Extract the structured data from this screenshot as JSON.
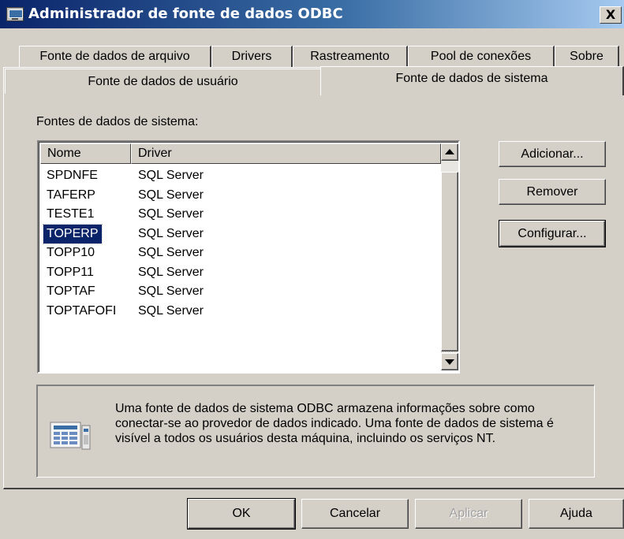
{
  "window": {
    "title": "Administrador de fonte de dados ODBC",
    "close_label": "X"
  },
  "tabs": [
    {
      "label": "Fonte de dados de arquivo"
    },
    {
      "label": "Drivers"
    },
    {
      "label": "Rastreamento"
    },
    {
      "label": "Pool de conexões"
    },
    {
      "label": "Sobre"
    },
    {
      "label": "Fonte de dados de usuário"
    },
    {
      "label": "Fonte de dados de sistema",
      "selected": true
    }
  ],
  "section_label": "Fontes de dados de sistema:",
  "list": {
    "columns": [
      "Nome",
      "Driver"
    ],
    "rows": [
      {
        "name": "SPDNFE",
        "driver": "SQL Server"
      },
      {
        "name": "TAFERP",
        "driver": "SQL Server"
      },
      {
        "name": "TESTE1",
        "driver": "SQL Server"
      },
      {
        "name": "TOPERP",
        "driver": "SQL Server",
        "selected": true
      },
      {
        "name": "TOPP10",
        "driver": "SQL Server"
      },
      {
        "name": "TOPP11",
        "driver": "SQL Server"
      },
      {
        "name": "TOPTAF",
        "driver": "SQL Server"
      },
      {
        "name": "TOPTAFOFI",
        "driver": "SQL Server"
      }
    ]
  },
  "side_buttons": {
    "add": "Adicionar...",
    "remove": "Remover",
    "configure": "Configurar..."
  },
  "info": {
    "text": "Uma fonte de dados de sistema ODBC armazena informações sobre como conectar-se ao provedor de dados indicado. Uma fonte de dados de sistema é visível a todos os usuários desta máquina, incluindo os serviços NT.",
    "icon": "database-document-icon"
  },
  "bottom_buttons": {
    "ok": "OK",
    "cancel": "Cancelar",
    "apply": "Aplicar",
    "help": "Ajuda"
  },
  "colors": {
    "face": "#d4d0c8",
    "title_start": "#0a246a",
    "title_end": "#a6caf0",
    "selection": "#0a246a"
  }
}
